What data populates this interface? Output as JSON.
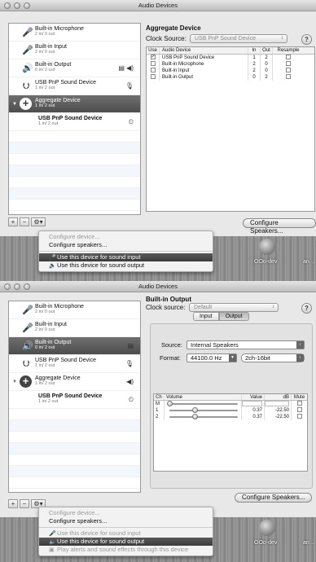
{
  "window_title": "Audio Devices",
  "desktop": {
    "labels": [
      "OOo-dev",
      "an…"
    ]
  },
  "devices": [
    {
      "name": "Built-in Microphone",
      "io": "2 in/ 0 out",
      "icon": "microphone-icon"
    },
    {
      "name": "Built-in Input",
      "io": "2 in/ 0 out",
      "icon": "microphone-icon"
    },
    {
      "name": "Built-in Output",
      "io": "0 in/ 2 out",
      "icon": "speaker-icon",
      "indicator": "▤ ◀)"
    },
    {
      "name": "USB PnP Sound Device",
      "io": "1 in/ 2 out",
      "icon": "usb-icon",
      "indicator": "🎙"
    },
    {
      "name": "Aggregate Device",
      "io": "1 in/ 2 out",
      "icon": "aggregate-plus-icon"
    },
    {
      "name": "USB PnP Sound Device",
      "io": "1 in/ 2 out",
      "indicator": "⏲"
    }
  ],
  "toolbar": {
    "add": "+",
    "remove": "−",
    "gear": "⚙▾"
  },
  "menu": {
    "configure_device": "Configure device...",
    "configure_speakers": "Configure speakers...",
    "use_input": "Use this device for sound input",
    "use_output": "Use this device for sound output",
    "play_alerts": "Play alerts and sound effects through this device"
  },
  "top": {
    "panel_title": "Aggregate Device",
    "clock_label": "Clock Source:",
    "clock_value": "USB PnP Sound Device",
    "help": "?",
    "table_headers": {
      "use": "Use",
      "device": "Audio Device",
      "in": "In",
      "out": "Out",
      "resample": "Resample"
    },
    "table_rows": [
      {
        "use": "✓",
        "device": "USB PnP Sound Device",
        "in": "1",
        "out": "2",
        "resample": ""
      },
      {
        "use": "",
        "device": "Built-in Microphone",
        "in": "2",
        "out": "0",
        "resample": ""
      },
      {
        "use": "",
        "device": "Built-in Input",
        "in": "2",
        "out": "0",
        "resample": ""
      },
      {
        "use": "",
        "device": "Built-in Output",
        "in": "0",
        "out": "2",
        "resample": ""
      }
    ],
    "configure_speakers": "Configure Speakers..."
  },
  "bottom": {
    "panel_title": "Built-in Output",
    "clock_label": "Clock source:",
    "clock_value": "Default",
    "help": "?",
    "tab_input": "Input",
    "tab_output": "Output",
    "source_label": "Source:",
    "source_value": "Internal Speakers",
    "format_label": "Format:",
    "format_rate": "44100.0 Hz",
    "format_bits": "2ch-16bit",
    "volume_headers": {
      "ch": "Ch",
      "volume": "Volume",
      "value": "Value",
      "db": "dB",
      "mute": "Mute"
    },
    "volume_rows": [
      {
        "ch": "M",
        "value": "",
        "db": "",
        "level": 0.0
      },
      {
        "ch": "1",
        "value": "0.37",
        "db": "-22.50",
        "level": 0.37
      },
      {
        "ch": "2",
        "value": "0.37",
        "db": "-22.50",
        "level": 0.37
      }
    ],
    "configure_speakers": "Configure Speakers..."
  }
}
